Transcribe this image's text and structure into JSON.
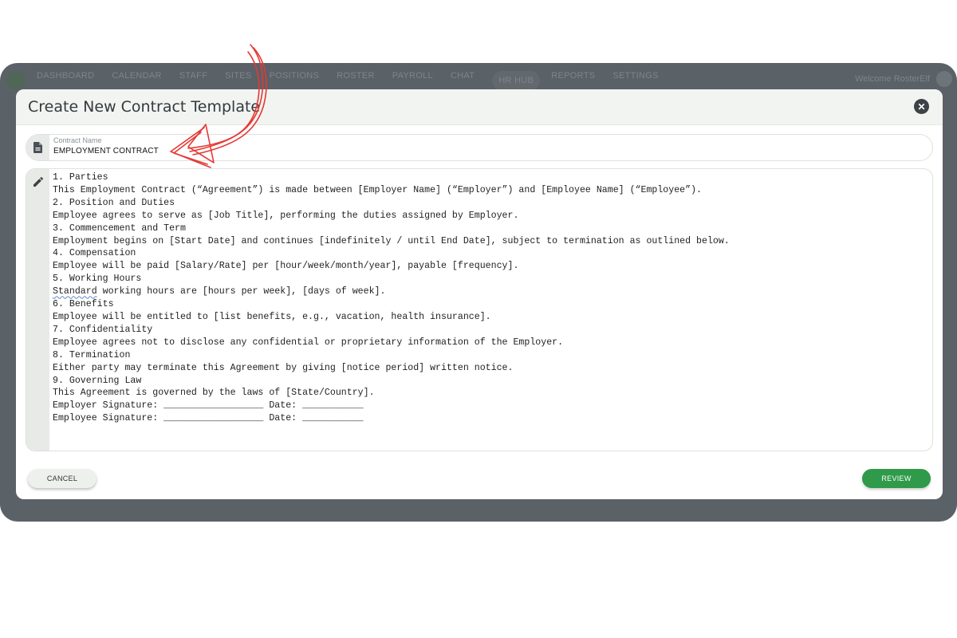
{
  "app": {
    "nav_items": [
      "DASHBOARD",
      "CALENDAR",
      "STAFF",
      "SITES",
      "POSITIONS",
      "ROSTER",
      "PAYROLL",
      "CHAT",
      "HR HUB",
      "REPORTS",
      "SETTINGS"
    ],
    "welcome_text": "Welcome RosterElf"
  },
  "modal": {
    "title": "Create New Contract Template",
    "close_icon": "close-icon",
    "contract_name": {
      "label": "Contract Name",
      "value": "EMPLOYMENT CONTRACT",
      "icon": "document-icon"
    },
    "contract_body": {
      "icon": "pencil-icon",
      "lines": [
        "1. Parties",
        "This Employment Contract (“Agreement”) is made between [Employer Name] (“Employer”) and [Employee Name] (“Employee”).",
        "2. Position and Duties",
        "Employee agrees to serve as [Job Title], performing the duties assigned by Employer.",
        "3. Commencement and Term",
        "Employment begins on [Start Date] and continues [indefinitely / until End Date], subject to termination as outlined below.",
        "4. Compensation",
        "Employee will be paid [Salary/Rate] per [hour/week/month/year], payable [frequency].",
        "5. Working Hours",
        "Standard working hours are [hours per week], [days of week].",
        "6. Benefits",
        "Employee will be entitled to [list benefits, e.g., vacation, health insurance].",
        "7. Confidentiality",
        "Employee agrees not to disclose any confidential or proprietary information of the Employer.",
        "8. Termination",
        "Either party may terminate this Agreement by giving [notice period] written notice.",
        "9. Governing Law",
        "This Agreement is governed by the laws of [State/Country].",
        "Employer Signature: __________________ Date: ___________",
        "Employee Signature: __________________ Date: ___________"
      ]
    },
    "buttons": {
      "cancel": "CANCEL",
      "review": "REVIEW"
    }
  },
  "colors": {
    "accent_green": "#2f9a49",
    "annotation_red": "#e53935",
    "backdrop": "#5a6167"
  }
}
